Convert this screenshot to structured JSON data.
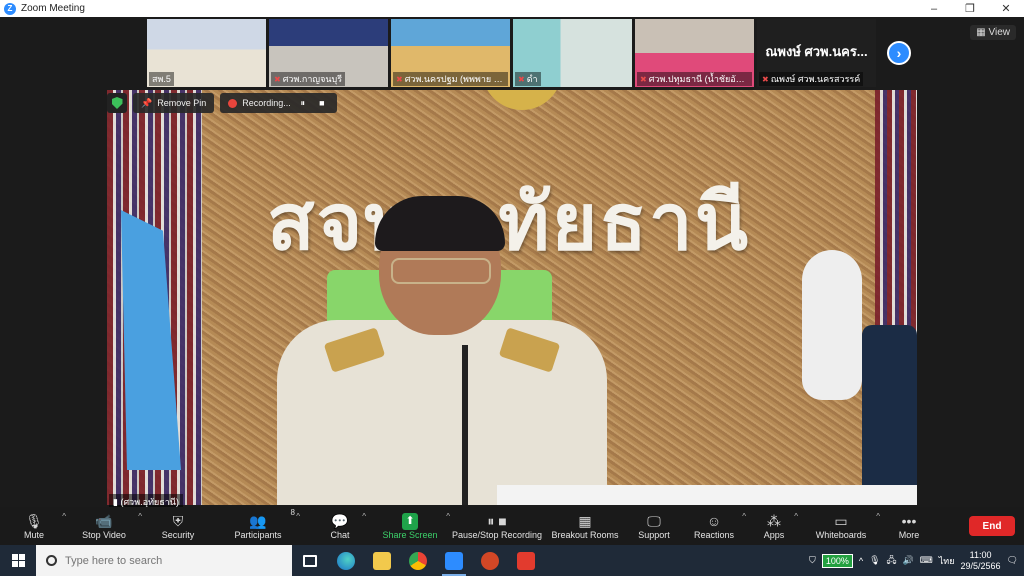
{
  "window": {
    "title": "Zoom Meeting",
    "controls": [
      "–",
      "❐",
      "✕"
    ]
  },
  "gallery": {
    "tiles": [
      {
        "name": "สพ.5"
      },
      {
        "name": "ศวพ.กาญจนบุรี"
      },
      {
        "name": "ศวพ.นครปฐม (พพพาย กา..."
      },
      {
        "name": "ดำ"
      },
      {
        "name": "ศวพ.ปทุมธานี (น้ำชัยอัน..."
      },
      {
        "name": "ณพงษ์ ศวพ.นครสวรรค์",
        "display": "ณพงษ์ ศวพ.นคร..."
      }
    ],
    "view_label": "View"
  },
  "main_video": {
    "wall_text": "สจพ.อุทัยธานี",
    "speaker_name": "(ศวพ.อุทัยธานี)",
    "remove_pin_label": "Remove Pin",
    "recording_label": "Recording...",
    "recording_pause_icon": "⏸",
    "recording_stop_icon": "■"
  },
  "toolbar": {
    "items": [
      {
        "label": "Mute",
        "icon": "mic-icon"
      },
      {
        "label": "Stop Video",
        "icon": "video-icon"
      },
      {
        "label": "Security",
        "icon": "shield-icon"
      },
      {
        "label": "Participants",
        "icon": "participants-icon",
        "count": "8"
      },
      {
        "label": "Chat",
        "icon": "chat-icon"
      },
      {
        "label": "Share Screen",
        "icon": "share-icon"
      },
      {
        "label": "Pause/Stop Recording",
        "icon": "record-icon"
      },
      {
        "label": "Breakout Rooms",
        "icon": "breakout-icon"
      },
      {
        "label": "Support",
        "icon": "support-icon"
      },
      {
        "label": "Reactions",
        "icon": "reactions-icon"
      },
      {
        "label": "Apps",
        "icon": "apps-icon"
      },
      {
        "label": "Whiteboards",
        "icon": "whiteboard-icon"
      },
      {
        "label": "More",
        "icon": "more-icon"
      }
    ],
    "end_label": "End",
    "share_color": "#1fa34a",
    "end_color": "#e02828"
  },
  "taskbar": {
    "search_placeholder": "Type here to search",
    "battery": "100%",
    "language": "ไทย",
    "time": "11:00",
    "date": "29/5/2566"
  }
}
